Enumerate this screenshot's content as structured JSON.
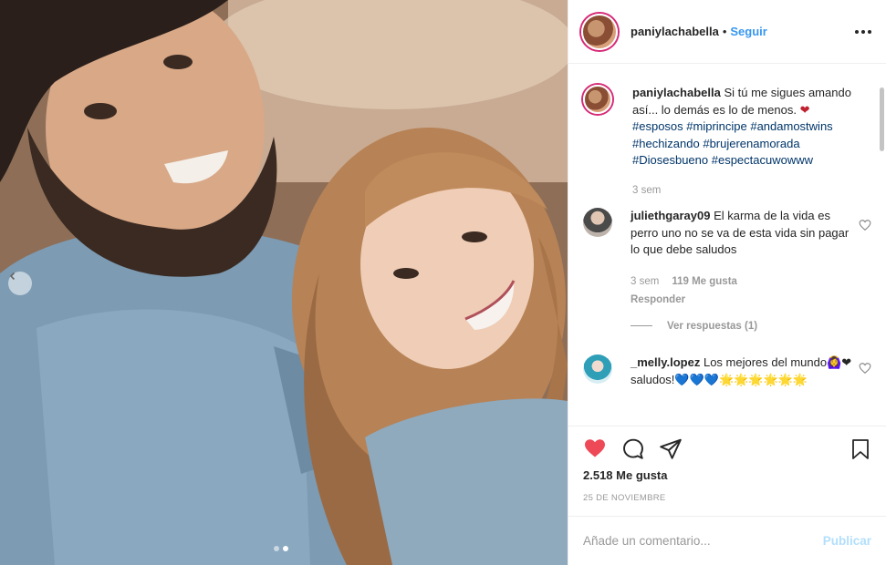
{
  "post": {
    "username": "paniylachabella",
    "separator": "•",
    "follow_label": "Seguir",
    "more_icon": "more-horizontal-icon"
  },
  "caption": {
    "username": "paniylachabella",
    "text": "Si tú me sigues amando así... lo demás es lo de menos.",
    "emoji": "❤",
    "hashtags": "#esposos #miprincipe #andamostwins #hechizando #brujerenamorada #Diosesbueno #espectacuwowww",
    "time": "3 sem"
  },
  "comments": [
    {
      "username": "juliethgaray09",
      "text": "El karma de la vida es perro uno no se va de esta vida sin pagar lo que debe saludos",
      "time": "3 sem",
      "likes": "119 Me gusta",
      "reply_label": "Responder",
      "view_replies": "Ver respuestas (1)"
    },
    {
      "username": "_melly.lopez",
      "text": "Los mejores del mundo🙆‍♀️❤ saludos!💙💙💙🌟🌟🌟🌟🌟🌟"
    }
  ],
  "actions": {
    "like_icon": "heart-filled-icon",
    "comment_icon": "comment-icon",
    "share_icon": "paper-plane-icon",
    "save_icon": "bookmark-icon"
  },
  "likes_count": "2.518 Me gusta",
  "date": "25 DE NOVIEMBRE",
  "add_comment": {
    "placeholder": "Añade un comentario...",
    "publish_label": "Publicar"
  },
  "colors": {
    "accent_blue": "#3897f0",
    "like_red": "#ed4956",
    "hashtag": "#003569",
    "muted": "#999999"
  }
}
